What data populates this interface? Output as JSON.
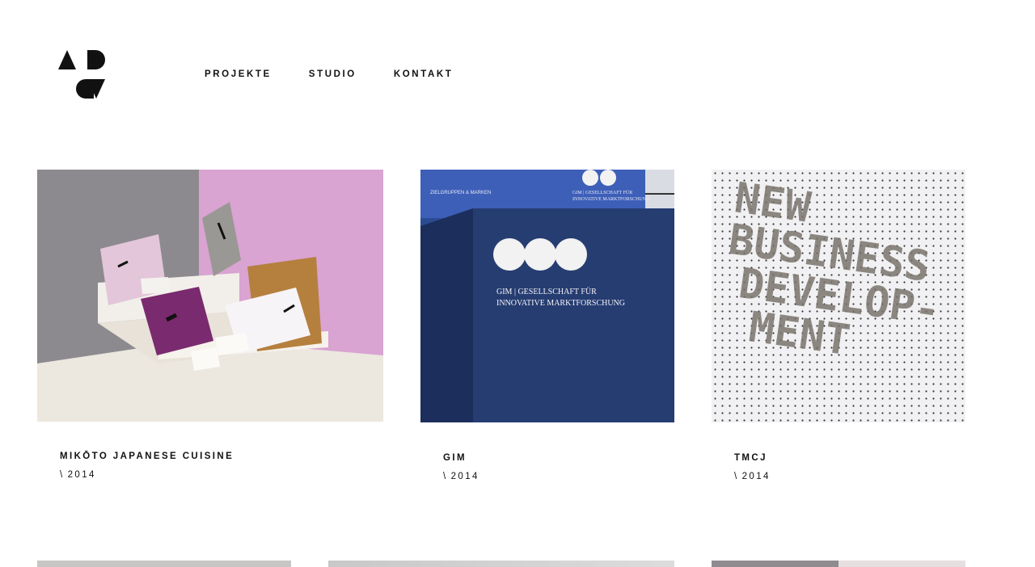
{
  "brand": {
    "logo_letters": "ADDV"
  },
  "nav": {
    "items": [
      "PROJEKTE",
      "STUDIO",
      "KONTAKT"
    ]
  },
  "projects": [
    {
      "title": "MIKŌTO JAPANESE CUISINE",
      "year_prefix": "\\",
      "year": "2014"
    },
    {
      "title": "GIM",
      "year_prefix": "\\",
      "year": "2014",
      "image_text": {
        "logo": "GIM",
        "line1": "GIM | GESELLSCHAFT FÜR",
        "line2": "INNOVATIVE MARKTFORSCHUNG",
        "banner": "ZIELGRUPPEN & MARKEN",
        "top_line1": "GIM | GESELLSCHAFT FÜR",
        "top_line2": "INNOVATIVE MARKTFORSCHUNG"
      }
    },
    {
      "title": "TMCJ",
      "year_prefix": "\\",
      "year": "2014",
      "image_text": {
        "words": [
          "NEW",
          "BUSINESS",
          "DEVELOP-",
          "MENT"
        ]
      }
    }
  ],
  "colors": {
    "pink_wall": "#d9a3d2",
    "grey_wall": "#8d8a8f",
    "navy": "#263d72",
    "purple_card": "#7a2a6e",
    "gold_box": "#b5803e"
  }
}
